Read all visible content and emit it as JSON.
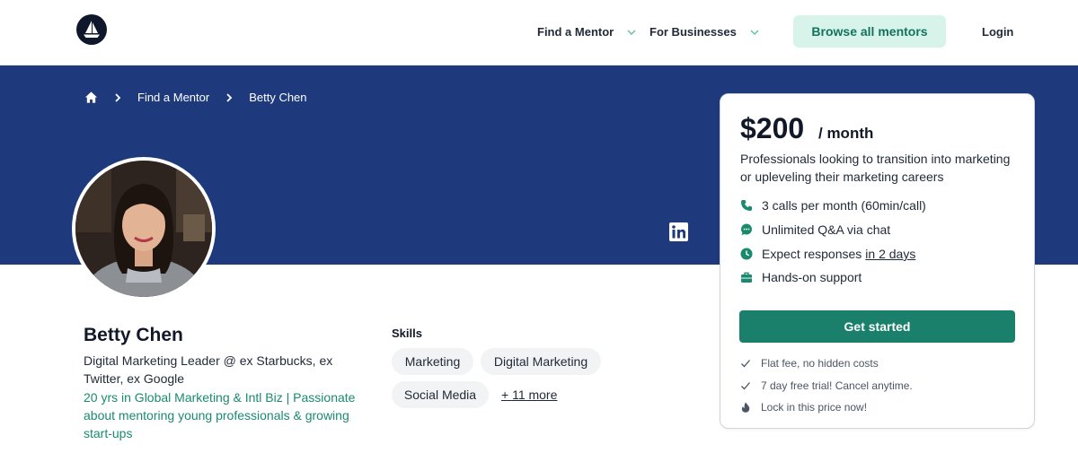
{
  "header": {
    "logo_icon": "sailboat-logo-icon",
    "nav": [
      {
        "label": "Find a Mentor",
        "icon": "chevron-down-icon"
      },
      {
        "label": "For Businesses",
        "icon": "chevron-down-icon"
      }
    ],
    "browse_button": "Browse all mentors",
    "login": "Login"
  },
  "breadcrumb": {
    "home_icon": "home-icon",
    "items": [
      "Find a Mentor",
      "Betty Chen"
    ]
  },
  "profile": {
    "name": "Betty Chen",
    "title": "Digital Marketing Leader @ ex Starbucks, ex Twitter, ex Google",
    "bio": "20 yrs in Global Marketing & Intl Biz | Passionate about mentoring young professionals & growing start-ups",
    "social_icon": "linkedin-icon"
  },
  "skills": {
    "heading": "Skills",
    "items": [
      "Marketing",
      "Digital Marketing",
      "Social Media"
    ],
    "more": "+ 11 more"
  },
  "pricing": {
    "price": "$200",
    "period": "/ month",
    "description": "Professionals looking to transition into marketing or upleveling their marketing careers",
    "features": [
      {
        "icon": "phone-icon",
        "text": "3 calls per month (60min/call)"
      },
      {
        "icon": "chat-icon",
        "text": "Unlimited Q&A via chat"
      },
      {
        "icon": "clock-icon",
        "text": "Expect responses",
        "link": "in 2 days"
      },
      {
        "icon": "briefcase-icon",
        "text": "Hands-on support"
      }
    ],
    "cta": "Get started",
    "notes": [
      {
        "icon": "check-icon",
        "text": "Flat fee, no hidden costs"
      },
      {
        "icon": "check-icon",
        "text": "7 day free trial! Cancel anytime."
      },
      {
        "icon": "fire-icon",
        "text": "Lock in this price now!"
      }
    ]
  },
  "colors": {
    "band": "#1e3a7c",
    "accent": "#1a7f6b",
    "accent_light": "#d8f3ea"
  }
}
